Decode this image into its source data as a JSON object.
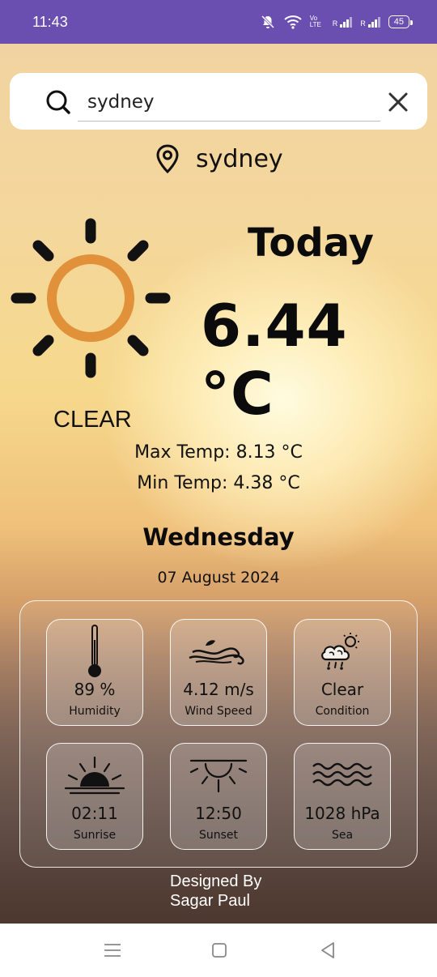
{
  "status_bar": {
    "time": "11:43",
    "battery": "45",
    "net1": "Vo LTE",
    "sig_label": "R"
  },
  "search": {
    "value": "sydney",
    "icon": "search-icon",
    "clear_icon": "close-icon"
  },
  "location": {
    "city": "sydney",
    "icon": "location-pin-icon"
  },
  "weather": {
    "heading": "Today",
    "temperature": "6.44 °C",
    "condition": "CLEAR",
    "max_temp": "Max Temp: 8.13 °C",
    "min_temp": "Min Temp: 4.38 °C",
    "day": "Wednesday",
    "date": "07 August 2024",
    "sun_color": "#e0913a"
  },
  "details": [
    {
      "value": "89 %",
      "label": "Humidity",
      "icon": "thermometer-icon"
    },
    {
      "value": "4.12 m/s",
      "label": "Wind Speed",
      "icon": "wind-icon"
    },
    {
      "value": "Clear",
      "label": "Condition",
      "icon": "cloud-sun-rain-icon"
    },
    {
      "value": "02:11",
      "label": "Sunrise",
      "icon": "sunrise-icon"
    },
    {
      "value": "12:50",
      "label": "Sunset",
      "icon": "sunset-icon"
    },
    {
      "value": "1028 hPa",
      "label": "Sea",
      "icon": "waves-icon"
    }
  ],
  "footer": {
    "line1": "Designed By",
    "line2": "Sagar Paul"
  }
}
